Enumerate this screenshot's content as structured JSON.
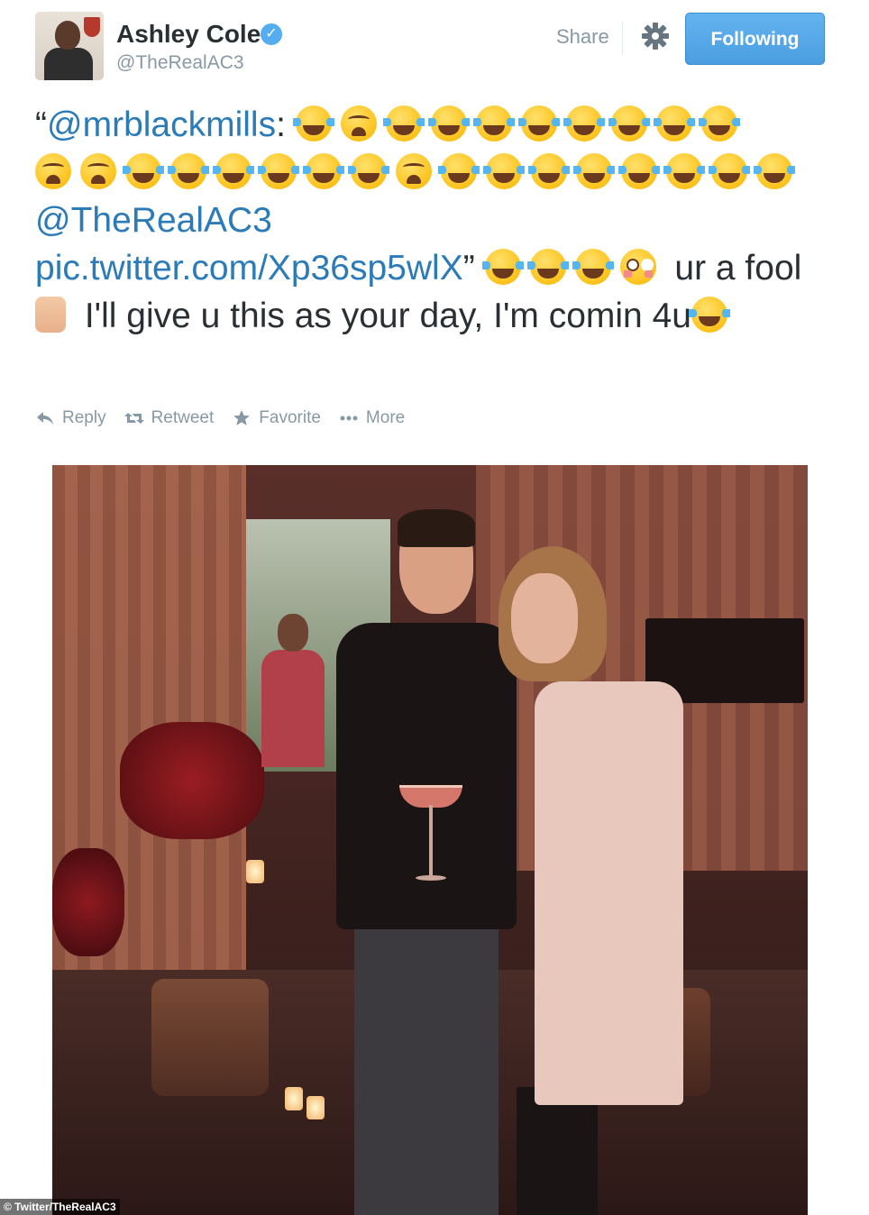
{
  "header": {
    "name": "Ashley Cole",
    "handle": "@TheRealAC3",
    "share_label": "Share",
    "follow_label": "Following",
    "verified_icon": "verified-checkmark"
  },
  "tweet": {
    "open_quote": "“",
    "mention1": "@mrblackmills",
    "colon": ":",
    "emoji_line1": [
      "joy",
      "weary",
      "joy",
      "joy",
      "joy",
      "joy",
      "joy",
      "joy",
      "joy",
      "joy"
    ],
    "emoji_line2": [
      "weary",
      "weary",
      "joy",
      "joy",
      "joy",
      "joy",
      "joy",
      "joy",
      "weary",
      "joy",
      "joy",
      "joy",
      "joy",
      "joy",
      "joy",
      "joy",
      "joy"
    ],
    "mention2": "@TheRealAC3",
    "pic_link": "pic.twitter.com/Xp36sp5wlX",
    "close_quote": "”",
    "emoji_line3": [
      "joy",
      "joy",
      "joy",
      "flushed"
    ],
    "text_part1": "ur a fool",
    "emoji_hands": "raised-hands",
    "text_part2": "I'll give u this as your day, I'm comin 4u",
    "emoji_end": "joy"
  },
  "actions": {
    "reply": "Reply",
    "retweet": "Retweet",
    "favorite": "Favorite",
    "more": "More"
  },
  "photo": {
    "credit": "© Twitter/TheRealAC3"
  },
  "colors": {
    "link": "#2b7bb9",
    "follow_button": "#55acee",
    "muted": "#8899a6"
  }
}
